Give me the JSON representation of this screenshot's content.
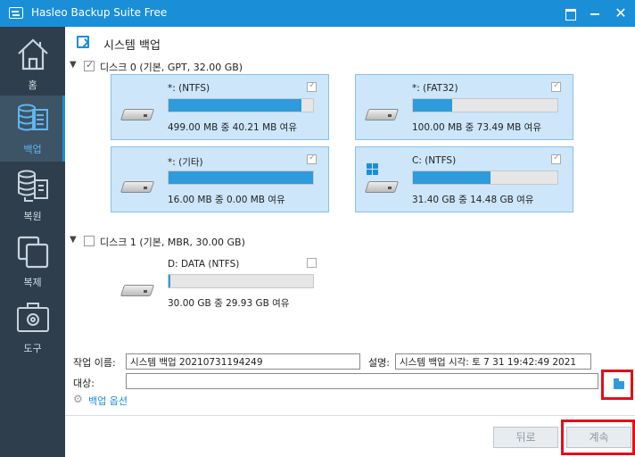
{
  "window": {
    "title": "Hasleo Backup Suite Free"
  },
  "sidebar": {
    "items": [
      {
        "label": "홈",
        "icon": "home-icon",
        "active": false
      },
      {
        "label": "백업",
        "icon": "backup-icon",
        "active": true
      },
      {
        "label": "복원",
        "icon": "restore-icon",
        "active": false
      },
      {
        "label": "복제",
        "icon": "clone-icon",
        "active": false
      },
      {
        "label": "도구",
        "icon": "tools-icon",
        "active": false
      }
    ]
  },
  "header": {
    "title": "시스템 백업"
  },
  "disks": [
    {
      "label": "디스크 0 (기본, GPT, 32.00 GB)",
      "checked": true,
      "partitions": [
        {
          "name": "*: (NTFS)",
          "info": "499.00 MB 중 40.21 MB 여유",
          "used_fraction": 0.92,
          "selected": true,
          "icon": "hdd-icon"
        },
        {
          "name": "*: (FAT32)",
          "info": "100.00 MB 중 73.49 MB 여유",
          "used_fraction": 0.27,
          "selected": true,
          "icon": "hdd-icon"
        },
        {
          "name": "*: (기타)",
          "info": "16.00 MB 중 0.00 MB 여유",
          "used_fraction": 1.0,
          "selected": true,
          "icon": "hdd-icon"
        },
        {
          "name": "C: (NTFS)",
          "info": "31.40 GB 중 14.48 GB 여유",
          "used_fraction": 0.54,
          "selected": true,
          "icon": "windows-hdd-icon"
        }
      ]
    },
    {
      "label": "디스크 1 (기본, MBR, 30.00 GB)",
      "checked": false,
      "partitions": [
        {
          "name": "D: DATA (NTFS)",
          "info": "30.00 GB 중 29.93 GB 여유",
          "used_fraction": 0.01,
          "selected": false,
          "icon": "hdd-icon"
        }
      ]
    }
  ],
  "form": {
    "task_name_label": "작업 이름:",
    "task_name_value": "시스템 백업 20210731194249",
    "description_label": "설명:",
    "description_value": "시스템 백업 시각: 토 7 31 19:42:49 2021",
    "destination_label": "대상:",
    "destination_value": "",
    "backup_options_label": "백업 옵션"
  },
  "buttons": {
    "back": "뒤로",
    "next": "계속"
  },
  "colors": {
    "accent": "#1a8fd8",
    "sidebar": "#2f3e4c",
    "highlight": "#e0101a",
    "bar_fill": "#2e9bdc"
  }
}
